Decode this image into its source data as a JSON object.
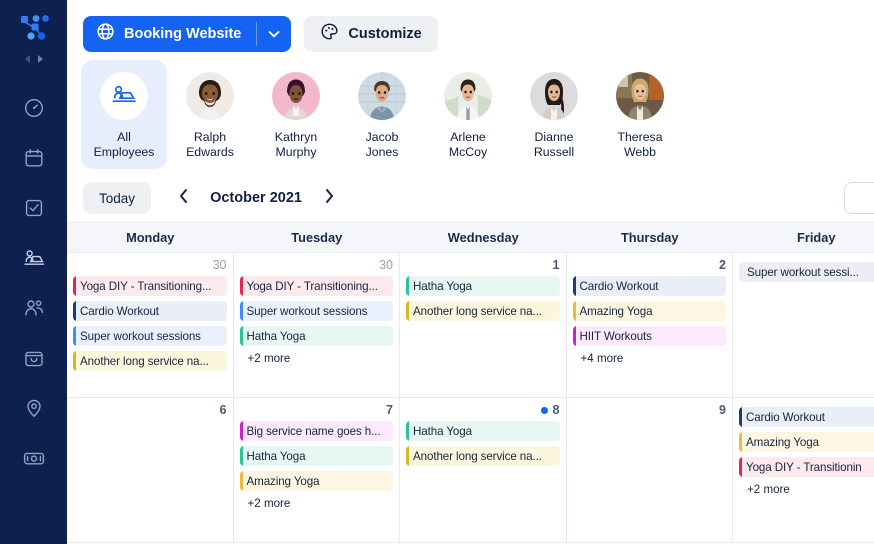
{
  "sidebar": {
    "logo_name": "app-logo",
    "nav_arrows": [
      "prev",
      "next"
    ],
    "items": [
      {
        "icon": "dashboard-gauge-icon",
        "label": "Dashboard"
      },
      {
        "icon": "calendar-icon",
        "label": "Calendar"
      },
      {
        "icon": "tasks-checklist-icon",
        "label": "Tasks"
      },
      {
        "icon": "employees-desk-icon",
        "label": "Employees"
      },
      {
        "icon": "clients-people-icon",
        "label": "Clients"
      },
      {
        "icon": "inbox-bag-icon",
        "label": "Inbox"
      },
      {
        "icon": "location-pin-icon",
        "label": "Locations"
      },
      {
        "icon": "payments-cash-icon",
        "label": "Payments"
      }
    ]
  },
  "toolbar": {
    "booking_website_label": "Booking Website",
    "booking_website_icon": "globe-icon",
    "dropdown_icon": "chevron-down-icon",
    "customize_label": "Customize",
    "customize_icon": "palette-icon",
    "primary_color": "#1463F3",
    "secondary_bg": "#eef0f4"
  },
  "employees": {
    "items": [
      {
        "name_line1": "All",
        "name_line2": "Employees",
        "avatar": "all-employees-icon",
        "active": true
      },
      {
        "name_line1": "Ralph",
        "name_line2": "Edwards",
        "avatar": "photo-ralph-edwards",
        "active": false
      },
      {
        "name_line1": "Kathryn",
        "name_line2": "Murphy",
        "avatar": "photo-kathryn-murphy",
        "active": false
      },
      {
        "name_line1": "Jacob",
        "name_line2": "Jones",
        "avatar": "photo-jacob-jones",
        "active": false
      },
      {
        "name_line1": "Arlene",
        "name_line2": "McCoy",
        "avatar": "photo-arlene-mccoy",
        "active": false
      },
      {
        "name_line1": "Dianne",
        "name_line2": "Russell",
        "avatar": "photo-dianne-russell",
        "active": false
      },
      {
        "name_line1": "Theresa",
        "name_line2": "Webb",
        "avatar": "photo-theresa-webb",
        "active": false
      }
    ]
  },
  "datebar": {
    "today_label": "Today",
    "prev_icon": "chevron-left-icon",
    "next_icon": "chevron-right-icon",
    "month_label": "October 2021"
  },
  "calendar": {
    "weekday_headers": [
      "Monday",
      "Tuesday",
      "Wednesday",
      "Thursday",
      "Friday"
    ],
    "rows": [
      {
        "cells": [
          {
            "day": "30",
            "muted": true,
            "today": false,
            "events": [
              {
                "title": "Yoga DIY - Transitioning...",
                "bar": "#E8264B",
                "bg": "#fdeaee"
              },
              {
                "title": "Cardio Workout",
                "bar": "#1B3E7A",
                "bg": "#eaeff7"
              },
              {
                "title": "Super workout sessions",
                "bar": "#3E8CF7",
                "bg": "#eaf1fd"
              },
              {
                "title": "Another long service na...",
                "bar": "#D9B520",
                "bg": "#fbf7dd"
              }
            ],
            "more": ""
          },
          {
            "day": "30",
            "muted": true,
            "today": false,
            "events": [
              {
                "title": "Yoga DIY - Transitioning...",
                "bar": "#E8264B",
                "bg": "#fdeaee"
              },
              {
                "title": "Super workout sessions",
                "bar": "#3E8CF7",
                "bg": "#eaf1fd"
              },
              {
                "title": "Hatha Yoga",
                "bar": "#2BC39A",
                "bg": "#e6f8f1"
              }
            ],
            "more": "+2 more"
          },
          {
            "day": "1",
            "muted": false,
            "today": false,
            "events": [
              {
                "title": "Hatha Yoga",
                "bar": "#2BC39A",
                "bg": "#e6f8f1"
              },
              {
                "title": "Another long service na...",
                "bar": "#D9B520",
                "bg": "#fbf7dd"
              }
            ],
            "more": ""
          },
          {
            "day": "2",
            "muted": false,
            "today": false,
            "events": [
              {
                "title": "Cardio Workout",
                "bar": "#1B3E7A",
                "bg": "#eaeff7"
              },
              {
                "title": "Amazing Yoga",
                "bar": "#EFB93B",
                "bg": "#fdf6e3"
              },
              {
                "title": "HIIT Workouts",
                "bar": "#CB1FD1",
                "bg": "#fbeafd"
              }
            ],
            "more": "+4 more"
          },
          {
            "day": "",
            "muted": false,
            "today": false,
            "events": [
              {
                "title": "Super workout sessi...",
                "bar": "",
                "bg": "#eceef3",
                "nobar": true
              }
            ],
            "more": ""
          }
        ]
      },
      {
        "cells": [
          {
            "day": "6",
            "muted": false,
            "today": false,
            "events": [],
            "more": ""
          },
          {
            "day": "7",
            "muted": false,
            "today": false,
            "events": [
              {
                "title": "Big service name goes h...",
                "bar": "#CB1FD1",
                "bg": "#fbeafd"
              },
              {
                "title": "Hatha Yoga",
                "bar": "#2BC39A",
                "bg": "#e6f8f1"
              },
              {
                "title": "Amazing Yoga",
                "bar": "#EFB93B",
                "bg": "#fdf6e3"
              }
            ],
            "more": "+2 more"
          },
          {
            "day": "8",
            "muted": false,
            "today": true,
            "events": [
              {
                "title": "Hatha Yoga",
                "bar": "#2BC39A",
                "bg": "#e6f8f1"
              },
              {
                "title": "Another long service na...",
                "bar": "#D9B520",
                "bg": "#fbf7dd"
              }
            ],
            "more": ""
          },
          {
            "day": "9",
            "muted": false,
            "today": false,
            "events": [],
            "more": ""
          },
          {
            "day": "",
            "muted": false,
            "today": false,
            "events": [
              {
                "title": "Cardio Workout",
                "bar": "#1B3E7A",
                "bg": "#eaeff7"
              },
              {
                "title": "Amazing Yoga",
                "bar": "#EFB93B",
                "bg": "#fdf6e3"
              },
              {
                "title": "Yoga DIY - Transitionin",
                "bar": "#E8264B",
                "bg": "#fdeaee"
              }
            ],
            "more": "+2 more"
          }
        ]
      }
    ]
  }
}
